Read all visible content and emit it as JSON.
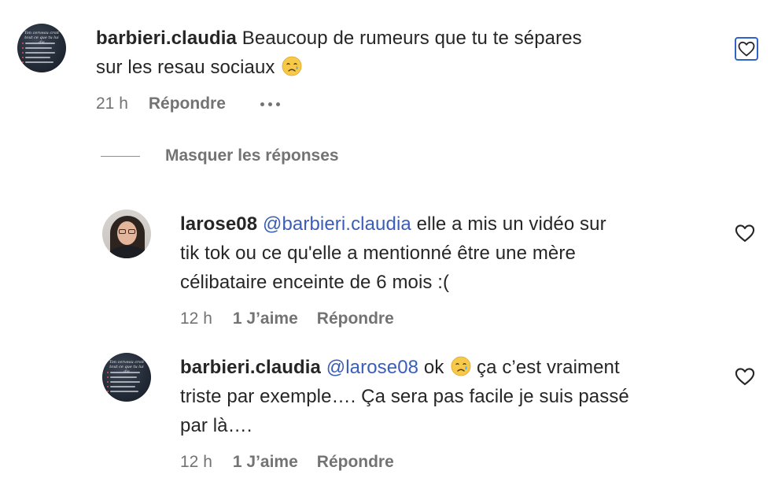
{
  "colors": {
    "text": "#262626",
    "muted": "#737373",
    "mention": "#3a5eb8",
    "focus": "#2f63c7"
  },
  "top_comment": {
    "username": "barbieri.claudia",
    "text": "Beaucoup de rumeurs que tu te sépares",
    "text_line2": "sur les resau sociaux",
    "emoji": "crying-face",
    "time": "21 h",
    "reply_label": "Répondre",
    "more_icon": "more-horizontal-icon",
    "avatar_caption": "Ton cerveau croit tout ce que tu lui dis"
  },
  "replies_toggle": {
    "label": "Masquer les réponses"
  },
  "replies": [
    {
      "username": "larose08",
      "mention": "@barbieri.claudia",
      "text_line1_rest": "elle a mis un vidéo sur",
      "text_line2": "tik tok ou ce qu'elle a mentionné être une mère",
      "text_line3": "célibataire enceinte de 6 mois :(",
      "time": "12 h",
      "likes": "1 J’aime",
      "reply_label": "Répondre"
    },
    {
      "username": "barbieri.claudia",
      "mention": "@larose08",
      "text_line1_a": "ok",
      "emoji": "crying-face",
      "text_line1_b": "ça c’est vraiment",
      "text_line2": "triste par exemple…. Ça sera pas facile je suis passé",
      "text_line3": "par là….",
      "time": "12 h",
      "likes": "1 J’aime",
      "reply_label": "Répondre"
    }
  ]
}
